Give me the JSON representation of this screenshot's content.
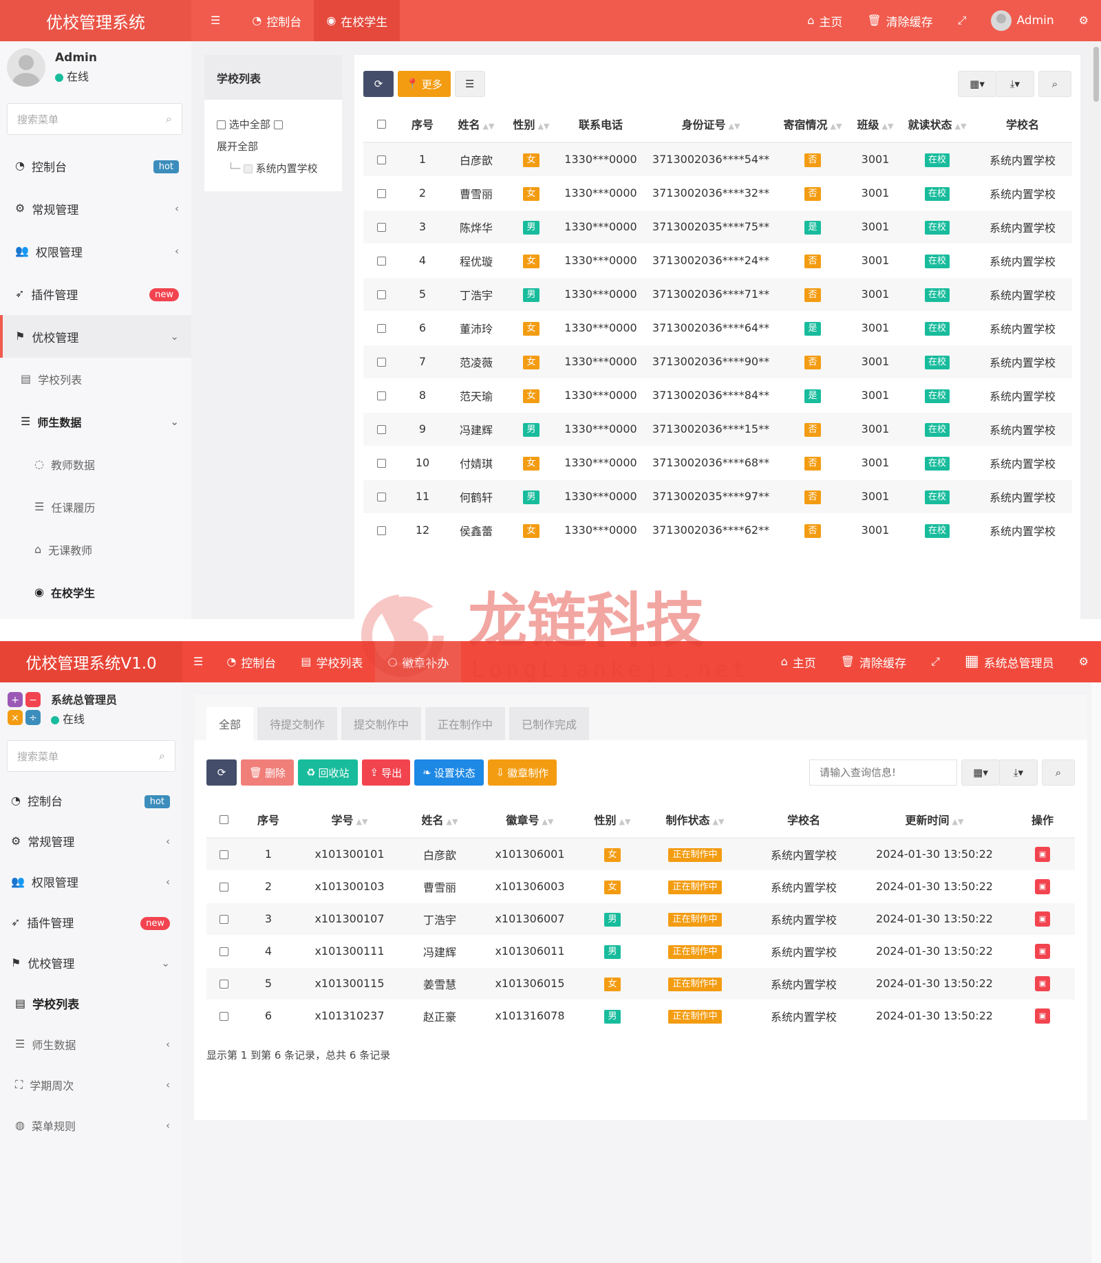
{
  "p1": {
    "app_title": "优校管理系统",
    "nav": {
      "dashboard": "控制台",
      "students": "在校学生",
      "home": "主页",
      "clear_cache": "清除缓存",
      "user": "Admin"
    },
    "user": {
      "name": "Admin",
      "status": "在线"
    },
    "search_placeholder": "搜索菜单",
    "menu": {
      "dashboard": "控制台",
      "dashboard_badge": "hot",
      "general": "常规管理",
      "permission": "权限管理",
      "plugin": "插件管理",
      "plugin_badge": "new",
      "school_mgmt": "优校管理",
      "school_list": "学校列表",
      "teacher_student": "师生数据",
      "teacher_data": "教师数据",
      "teaching_record": "任课履历",
      "no_class_teacher": "无课教师",
      "students_in_school": "在校学生"
    },
    "school_panel": {
      "title": "学校列表",
      "select_all": "选中全部",
      "expand_all": "展开全部",
      "school_name": "系统内置学校"
    },
    "toolbar": {
      "more": "更多"
    },
    "table": {
      "headers": [
        "序号",
        "姓名",
        "性别",
        "联系电话",
        "身份证号",
        "寄宿情况",
        "班级",
        "就读状态",
        "学校名"
      ],
      "rows": [
        {
          "no": "1",
          "name": "白彦歆",
          "gender": "女",
          "phone": "1330***0000",
          "id": "3713002036****54**",
          "board": "否",
          "class": "3001",
          "status": "在校",
          "school": "系统内置学校"
        },
        {
          "no": "2",
          "name": "曹雪丽",
          "gender": "女",
          "phone": "1330***0000",
          "id": "3713002036****32**",
          "board": "否",
          "class": "3001",
          "status": "在校",
          "school": "系统内置学校"
        },
        {
          "no": "3",
          "name": "陈烨华",
          "gender": "男",
          "phone": "1330***0000",
          "id": "3713002035****75**",
          "board": "是",
          "class": "3001",
          "status": "在校",
          "school": "系统内置学校"
        },
        {
          "no": "4",
          "name": "程优璇",
          "gender": "女",
          "phone": "1330***0000",
          "id": "3713002036****24**",
          "board": "否",
          "class": "3001",
          "status": "在校",
          "school": "系统内置学校"
        },
        {
          "no": "5",
          "name": "丁浩宇",
          "gender": "男",
          "phone": "1330***0000",
          "id": "3713002036****71**",
          "board": "否",
          "class": "3001",
          "status": "在校",
          "school": "系统内置学校"
        },
        {
          "no": "6",
          "name": "董沛玲",
          "gender": "女",
          "phone": "1330***0000",
          "id": "3713002036****64**",
          "board": "是",
          "class": "3001",
          "status": "在校",
          "school": "系统内置学校"
        },
        {
          "no": "7",
          "name": "范凌薇",
          "gender": "女",
          "phone": "1330***0000",
          "id": "3713002036****90**",
          "board": "否",
          "class": "3001",
          "status": "在校",
          "school": "系统内置学校"
        },
        {
          "no": "8",
          "name": "范天瑜",
          "gender": "女",
          "phone": "1330***0000",
          "id": "3713002036****84**",
          "board": "是",
          "class": "3001",
          "status": "在校",
          "school": "系统内置学校"
        },
        {
          "no": "9",
          "name": "冯建辉",
          "gender": "男",
          "phone": "1330***0000",
          "id": "3713002036****15**",
          "board": "否",
          "class": "3001",
          "status": "在校",
          "school": "系统内置学校"
        },
        {
          "no": "10",
          "name": "付婧琪",
          "gender": "女",
          "phone": "1330***0000",
          "id": "3713002036****68**",
          "board": "否",
          "class": "3001",
          "status": "在校",
          "school": "系统内置学校"
        },
        {
          "no": "11",
          "name": "何鹤轩",
          "gender": "男",
          "phone": "1330***0000",
          "id": "3713002035****97**",
          "board": "否",
          "class": "3001",
          "status": "在校",
          "school": "系统内置学校"
        },
        {
          "no": "12",
          "name": "侯鑫蕾",
          "gender": "女",
          "phone": "1330***0000",
          "id": "3713002036****62**",
          "board": "否",
          "class": "3001",
          "status": "在校",
          "school": "系统内置学校"
        }
      ]
    }
  },
  "watermark": {
    "brand": "龙链科技",
    "url": "LongLiankeji.net"
  },
  "p2": {
    "app_title": "优校管理系统V1.0",
    "nav": {
      "dashboard": "控制台",
      "school_list": "学校列表",
      "badge_reissue": "徽章补办",
      "home": "主页",
      "clear_cache": "清除缓存",
      "user": "系统总管理员"
    },
    "user": {
      "name": "系统总管理员",
      "status": "在线"
    },
    "search_placeholder": "搜索菜单",
    "menu": {
      "dashboard": "控制台",
      "dashboard_badge": "hot",
      "general": "常规管理",
      "permission": "权限管理",
      "plugin": "插件管理",
      "plugin_badge": "new",
      "school_mgmt": "优校管理",
      "school_list": "学校列表",
      "teacher_student": "师生数据",
      "term_week": "学期周次",
      "menu_rules": "菜单规则"
    },
    "tabs": [
      "全部",
      "待提交制作",
      "提交制作中",
      "正在制作中",
      "已制作完成"
    ],
    "toolbar": {
      "delete": "删除",
      "recycle": "回收站",
      "export": "导出",
      "set_status": "设置状态",
      "make_badge": "徽章制作",
      "search_placeholder": "请输入查询信息!"
    },
    "table": {
      "headers": [
        "序号",
        "学号",
        "姓名",
        "徽章号",
        "性别",
        "制作状态",
        "学校名",
        "更新时间",
        "操作"
      ],
      "rows": [
        {
          "no": "1",
          "sid": "x101300101",
          "name": "白彦歆",
          "badge": "x101306001",
          "gender": "女",
          "state": "正在制作中",
          "school": "系统内置学校",
          "time": "2024-01-30 13:50:22"
        },
        {
          "no": "2",
          "sid": "x101300103",
          "name": "曹雪丽",
          "badge": "x101306003",
          "gender": "女",
          "state": "正在制作中",
          "school": "系统内置学校",
          "time": "2024-01-30 13:50:22"
        },
        {
          "no": "3",
          "sid": "x101300107",
          "name": "丁浩宇",
          "badge": "x101306007",
          "gender": "男",
          "state": "正在制作中",
          "school": "系统内置学校",
          "time": "2024-01-30 13:50:22"
        },
        {
          "no": "4",
          "sid": "x101300111",
          "name": "冯建辉",
          "badge": "x101306011",
          "gender": "男",
          "state": "正在制作中",
          "school": "系统内置学校",
          "time": "2024-01-30 13:50:22"
        },
        {
          "no": "5",
          "sid": "x101300115",
          "name": "姜雪慧",
          "badge": "x101306015",
          "gender": "女",
          "state": "正在制作中",
          "school": "系统内置学校",
          "time": "2024-01-30 13:50:22"
        },
        {
          "no": "6",
          "sid": "x101310237",
          "name": "赵正豪",
          "badge": "x101316078",
          "gender": "男",
          "state": "正在制作中",
          "school": "系统内置学校",
          "time": "2024-01-30 13:50:22"
        }
      ],
      "footer": "显示第 1 到第 6 条记录，总共 6 条记录"
    }
  },
  "colors": {
    "header_red": "#f15b4d",
    "green": "#18bc9c",
    "orange": "#f39c12",
    "blue": "#3c8dbc"
  },
  "icons": [
    "bars-icon",
    "dashboard-icon",
    "user-circle-icon",
    "home-icon",
    "trash-icon",
    "fullscreen-icon",
    "cogs-icon",
    "search-icon",
    "refresh-icon",
    "columns-icon",
    "export-icon",
    "flag-icon",
    "rocket-icon",
    "users-icon",
    "database-icon"
  ]
}
